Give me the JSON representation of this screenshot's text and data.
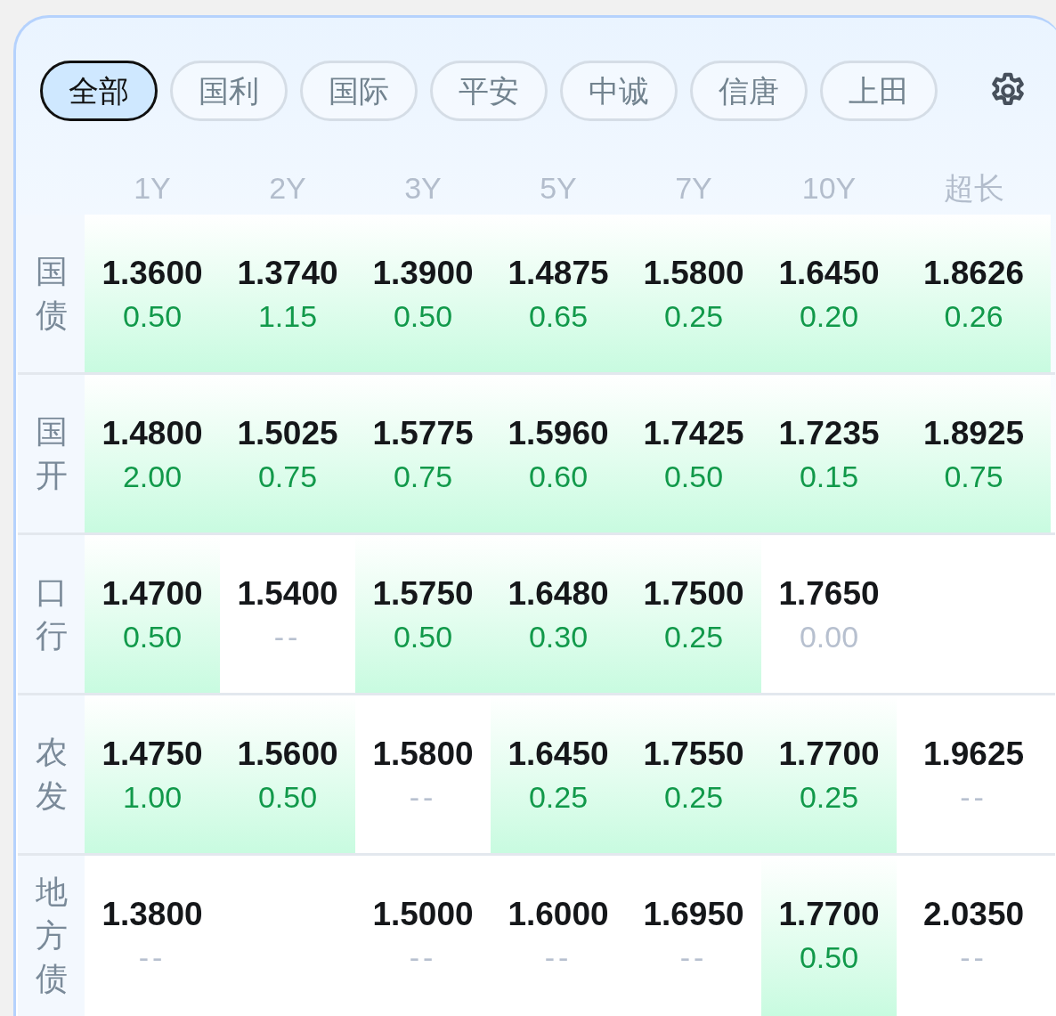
{
  "tabs": [
    {
      "label": "全部",
      "selected": true
    },
    {
      "label": "国利",
      "selected": false
    },
    {
      "label": "国际",
      "selected": false
    },
    {
      "label": "平安",
      "selected": false
    },
    {
      "label": "中诚",
      "selected": false
    },
    {
      "label": "信唐",
      "selected": false
    },
    {
      "label": "上田",
      "selected": false
    }
  ],
  "columns": [
    "1Y",
    "2Y",
    "3Y",
    "5Y",
    "7Y",
    "10Y",
    "超长"
  ],
  "rows": [
    {
      "label": "国债",
      "cells": [
        {
          "kind": "up",
          "rate": "1.3600",
          "change": "0.50"
        },
        {
          "kind": "up",
          "rate": "1.3740",
          "change": "1.15"
        },
        {
          "kind": "up",
          "rate": "1.3900",
          "change": "0.50"
        },
        {
          "kind": "up",
          "rate": "1.4875",
          "change": "0.65"
        },
        {
          "kind": "up",
          "rate": "1.5800",
          "change": "0.25"
        },
        {
          "kind": "up",
          "rate": "1.6450",
          "change": "0.20"
        },
        {
          "kind": "up",
          "rate": "1.8626",
          "change": "0.26"
        }
      ]
    },
    {
      "label": "国开",
      "cells": [
        {
          "kind": "up",
          "rate": "1.4800",
          "change": "2.00"
        },
        {
          "kind": "up",
          "rate": "1.5025",
          "change": "0.75"
        },
        {
          "kind": "up",
          "rate": "1.5775",
          "change": "0.75"
        },
        {
          "kind": "up",
          "rate": "1.5960",
          "change": "0.60"
        },
        {
          "kind": "up",
          "rate": "1.7425",
          "change": "0.50"
        },
        {
          "kind": "up",
          "rate": "1.7235",
          "change": "0.15"
        },
        {
          "kind": "up",
          "rate": "1.8925",
          "change": "0.75"
        }
      ]
    },
    {
      "label": "口行",
      "cells": [
        {
          "kind": "up",
          "rate": "1.4700",
          "change": "0.50"
        },
        {
          "kind": "none",
          "rate": "1.5400",
          "change": "--"
        },
        {
          "kind": "up",
          "rate": "1.5750",
          "change": "0.50"
        },
        {
          "kind": "up",
          "rate": "1.6480",
          "change": "0.30"
        },
        {
          "kind": "up",
          "rate": "1.7500",
          "change": "0.25"
        },
        {
          "kind": "flat",
          "rate": "1.7650",
          "change": "0.00"
        },
        {
          "kind": "empty"
        }
      ]
    },
    {
      "label": "农发",
      "cells": [
        {
          "kind": "up",
          "rate": "1.4750",
          "change": "1.00"
        },
        {
          "kind": "up",
          "rate": "1.5600",
          "change": "0.50"
        },
        {
          "kind": "none",
          "rate": "1.5800",
          "change": "--"
        },
        {
          "kind": "up",
          "rate": "1.6450",
          "change": "0.25"
        },
        {
          "kind": "up",
          "rate": "1.7550",
          "change": "0.25"
        },
        {
          "kind": "up",
          "rate": "1.7700",
          "change": "0.25"
        },
        {
          "kind": "none",
          "rate": "1.9625",
          "change": "--"
        }
      ]
    },
    {
      "label": "地方债",
      "cells": [
        {
          "kind": "none",
          "rate": "1.3800",
          "change": "--"
        },
        {
          "kind": "empty"
        },
        {
          "kind": "none",
          "rate": "1.5000",
          "change": "--"
        },
        {
          "kind": "none",
          "rate": "1.6000",
          "change": "--"
        },
        {
          "kind": "none",
          "rate": "1.6950",
          "change": "--"
        },
        {
          "kind": "up",
          "rate": "1.7700",
          "change": "0.50"
        },
        {
          "kind": "none",
          "rate": "2.0350",
          "change": "--"
        }
      ]
    }
  ]
}
